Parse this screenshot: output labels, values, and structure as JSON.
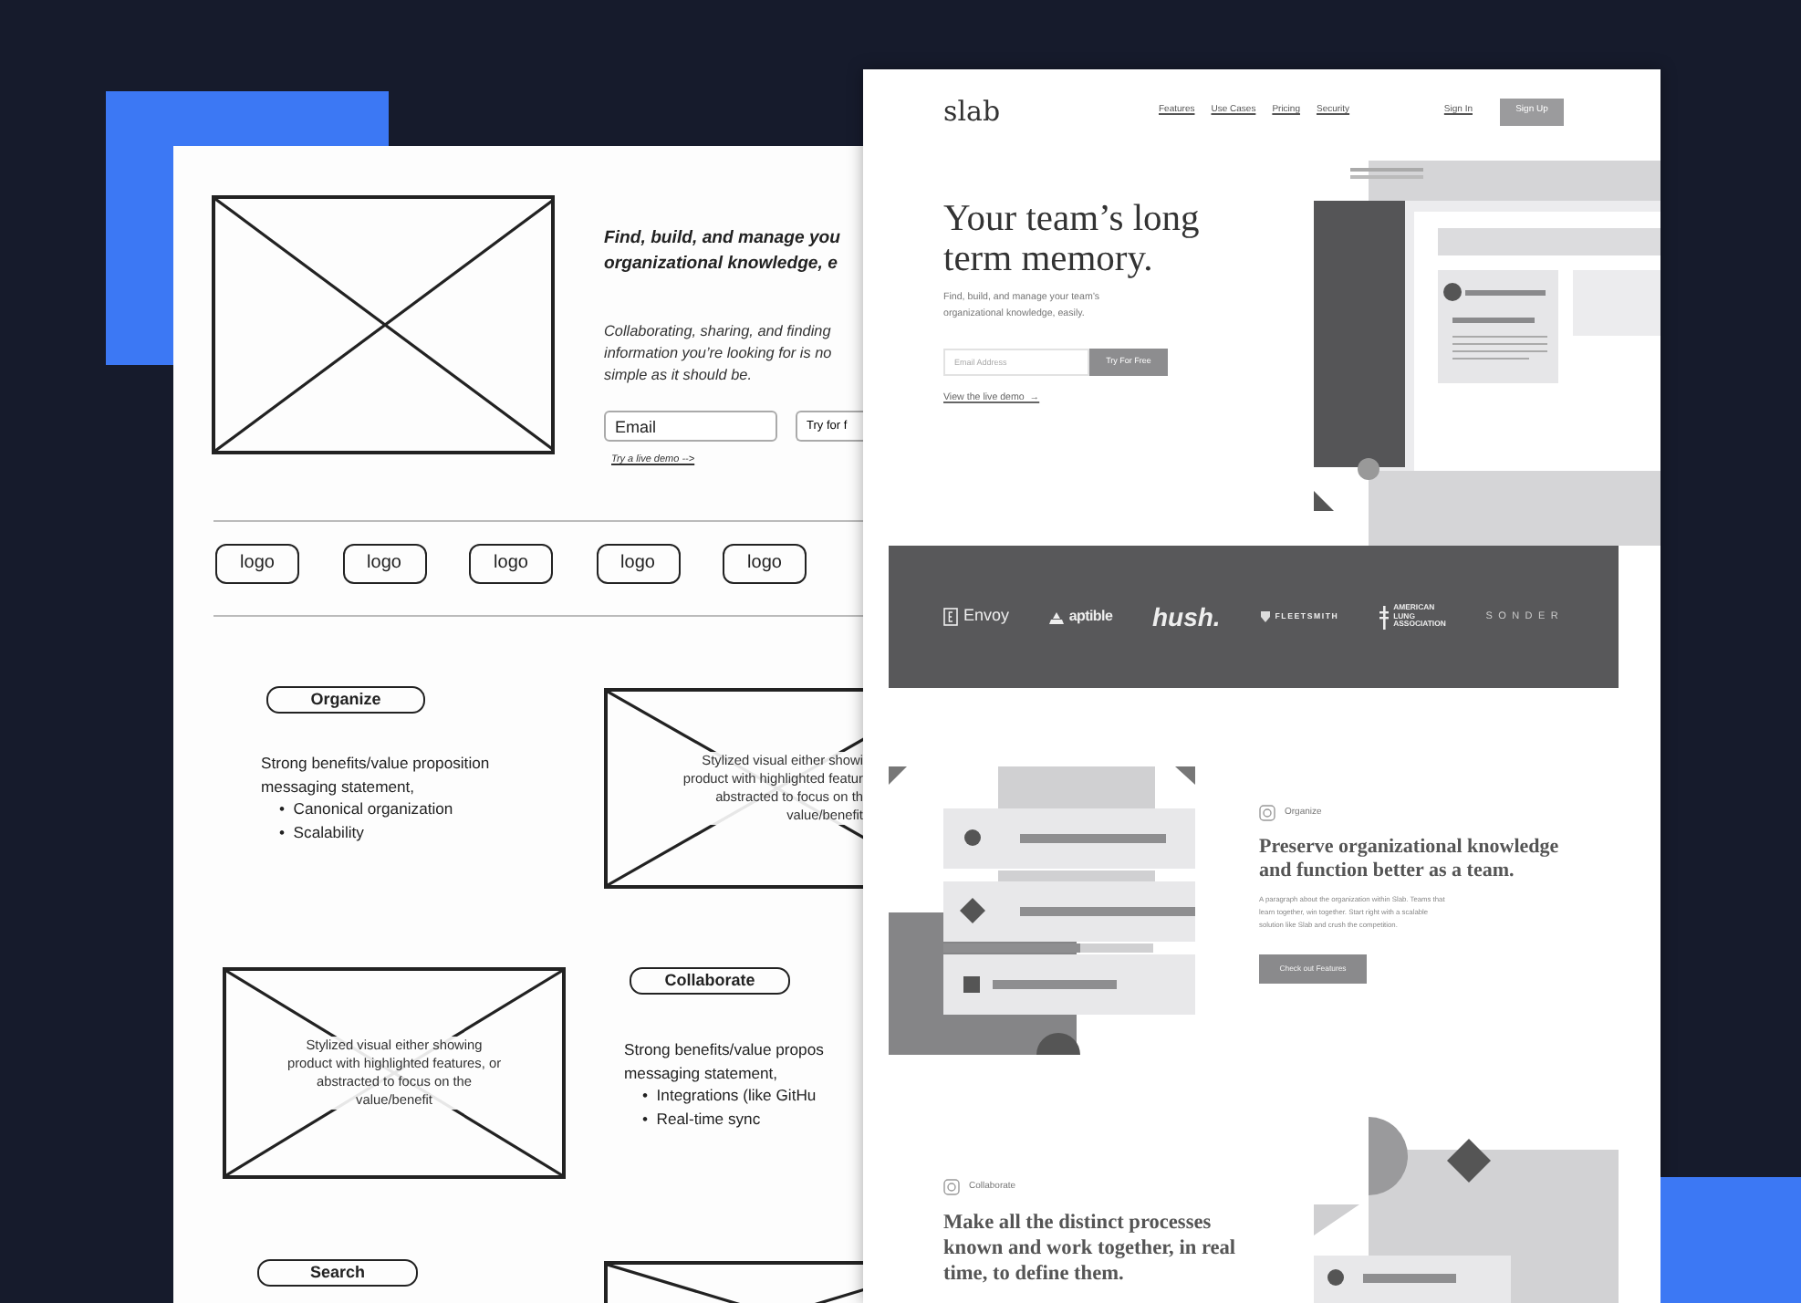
{
  "wireframe": {
    "hero": {
      "headline_lines": [
        "Find, build, and manage you",
        "organizational knowledge, e"
      ],
      "subtext_lines": [
        "Collaborating, sharing, and finding",
        "information you’re looking for is no",
        "simple as it should be."
      ],
      "email_field": {
        "value": "Email"
      },
      "cta_button": "Try for f",
      "demo_link": "Try a live demo -->"
    },
    "logos": [
      "logo",
      "logo",
      "logo",
      "logo",
      "logo"
    ],
    "feature_rows": [
      {
        "cells": [
          {
            "kind": "text",
            "tag": "Organize",
            "statement_lines": [
              "Strong benefits/value proposition",
              "messaging statement,"
            ],
            "bullets": [
              "•  Canonical organization",
              "•  Scalability"
            ]
          },
          {
            "kind": "placeholder",
            "caption_lines": [
              "Stylized visual either showi",
              "product with highlighted featur",
              "abstracted to focus on th",
              "value/benefit"
            ]
          }
        ]
      },
      {
        "cells": [
          {
            "kind": "placeholder",
            "caption_lines": [
              "Stylized visual either showing",
              "product with highlighted features, or",
              "abstracted to focus on the",
              "value/benefit"
            ]
          },
          {
            "kind": "text",
            "tag": "Collaborate",
            "statement_lines": [
              "Strong benefits/value propos",
              "messaging statement,"
            ],
            "bullets": [
              "•  Integrations (like GitHu",
              "•  Real-time sync"
            ]
          }
        ]
      },
      {
        "cells": [
          {
            "kind": "text",
            "tag": "Search"
          },
          {
            "kind": "placeholder"
          }
        ]
      }
    ]
  },
  "mockup": {
    "logo": "slab",
    "nav_links": [
      "Features",
      "Use Cases",
      "Pricing",
      "Security"
    ],
    "sign_in": "Sign In",
    "sign_up": "Sign Up",
    "hero": {
      "title_lines": [
        "Your team’s long",
        "term memory."
      ],
      "subtitle_lines": [
        "Find, build, and manage your team’s",
        "organizational knowledge, easily."
      ],
      "email_placeholder": "Email Address",
      "cta": "Try For Free",
      "demo_link": "View the live demo  →"
    },
    "customer_logos": [
      {
        "kind": "envoy",
        "lines": [
          "Envoy"
        ]
      },
      {
        "kind": "aptible",
        "lines": [
          "aptible"
        ]
      },
      {
        "kind": "hush",
        "lines": [
          "hush."
        ]
      },
      {
        "kind": "fleetsmith",
        "lines": [
          "FLEETSMITH"
        ]
      },
      {
        "kind": "ala",
        "lines": [
          "AMERICAN",
          "LUNG",
          "ASSOCIATION"
        ]
      },
      {
        "kind": "sonder",
        "lines": [
          "SONDER"
        ]
      }
    ],
    "features": [
      {
        "kind": "imagefirst",
        "tag": "Organize",
        "title_lines": [
          "Preserve organizational knowledge",
          "and function better as a team."
        ],
        "paragraph_lines": [
          "A paragraph about the organization within Slab. Teams that",
          "learn together, win together. Start right with a scalable",
          "solution like Slab and crush the competition."
        ],
        "button": "Check out Features"
      },
      {
        "kind": "textfirst",
        "tag": "Collaborate",
        "title_lines": [
          "Make all the distinct processes",
          "known and work together, in real",
          "time, to define them."
        ]
      }
    ]
  }
}
